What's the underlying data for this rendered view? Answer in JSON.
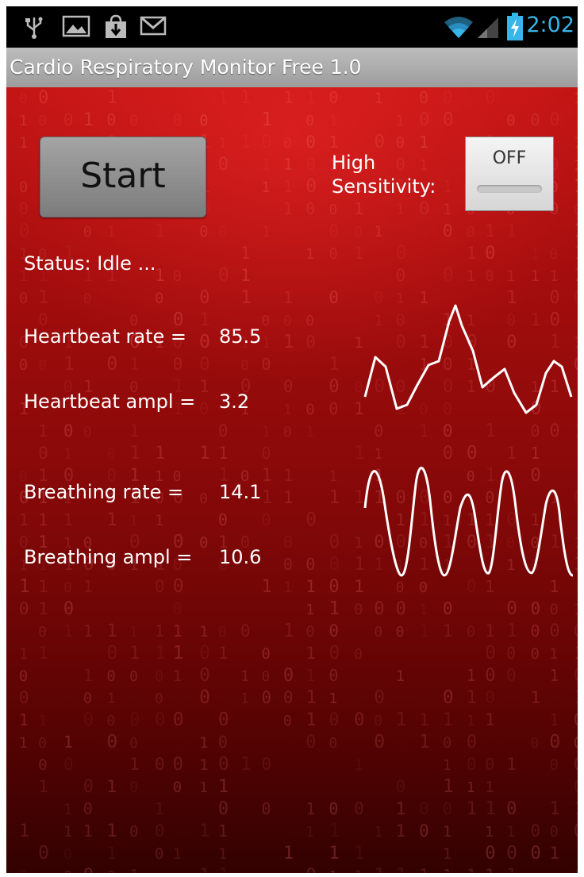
{
  "status_bar": {
    "left_icons": [
      "usb-icon",
      "image-icon",
      "download-bag-icon",
      "gmail-icon"
    ],
    "right_icons": [
      "wifi-icon",
      "signal-icon",
      "battery-charging-icon"
    ],
    "time": "2:02",
    "accent_color": "#38b6e8"
  },
  "app": {
    "title": "Cardio Respiratory Monitor Free  1.0"
  },
  "controls": {
    "start_label": "Start",
    "sensitivity_label_line1": "High",
    "sensitivity_label_line2": "Sensitivity:",
    "toggle_state": "OFF"
  },
  "status": {
    "text": "Status:  Idle ..."
  },
  "metrics": {
    "heartbeat_rate_label": "Heartbeat rate   =",
    "heartbeat_rate_value": "85.5",
    "heartbeat_ampl_label": "Heartbeat ampl =",
    "heartbeat_ampl_value": "3.2",
    "breathing_rate_label": "Breathing rate   =",
    "breathing_rate_value": "14.1",
    "breathing_ampl_label": "Breathing ampl =",
    "breathing_ampl_value": "10.6"
  },
  "colors": {
    "background_red": "#a30d0d",
    "waveform": "#ffffff"
  }
}
